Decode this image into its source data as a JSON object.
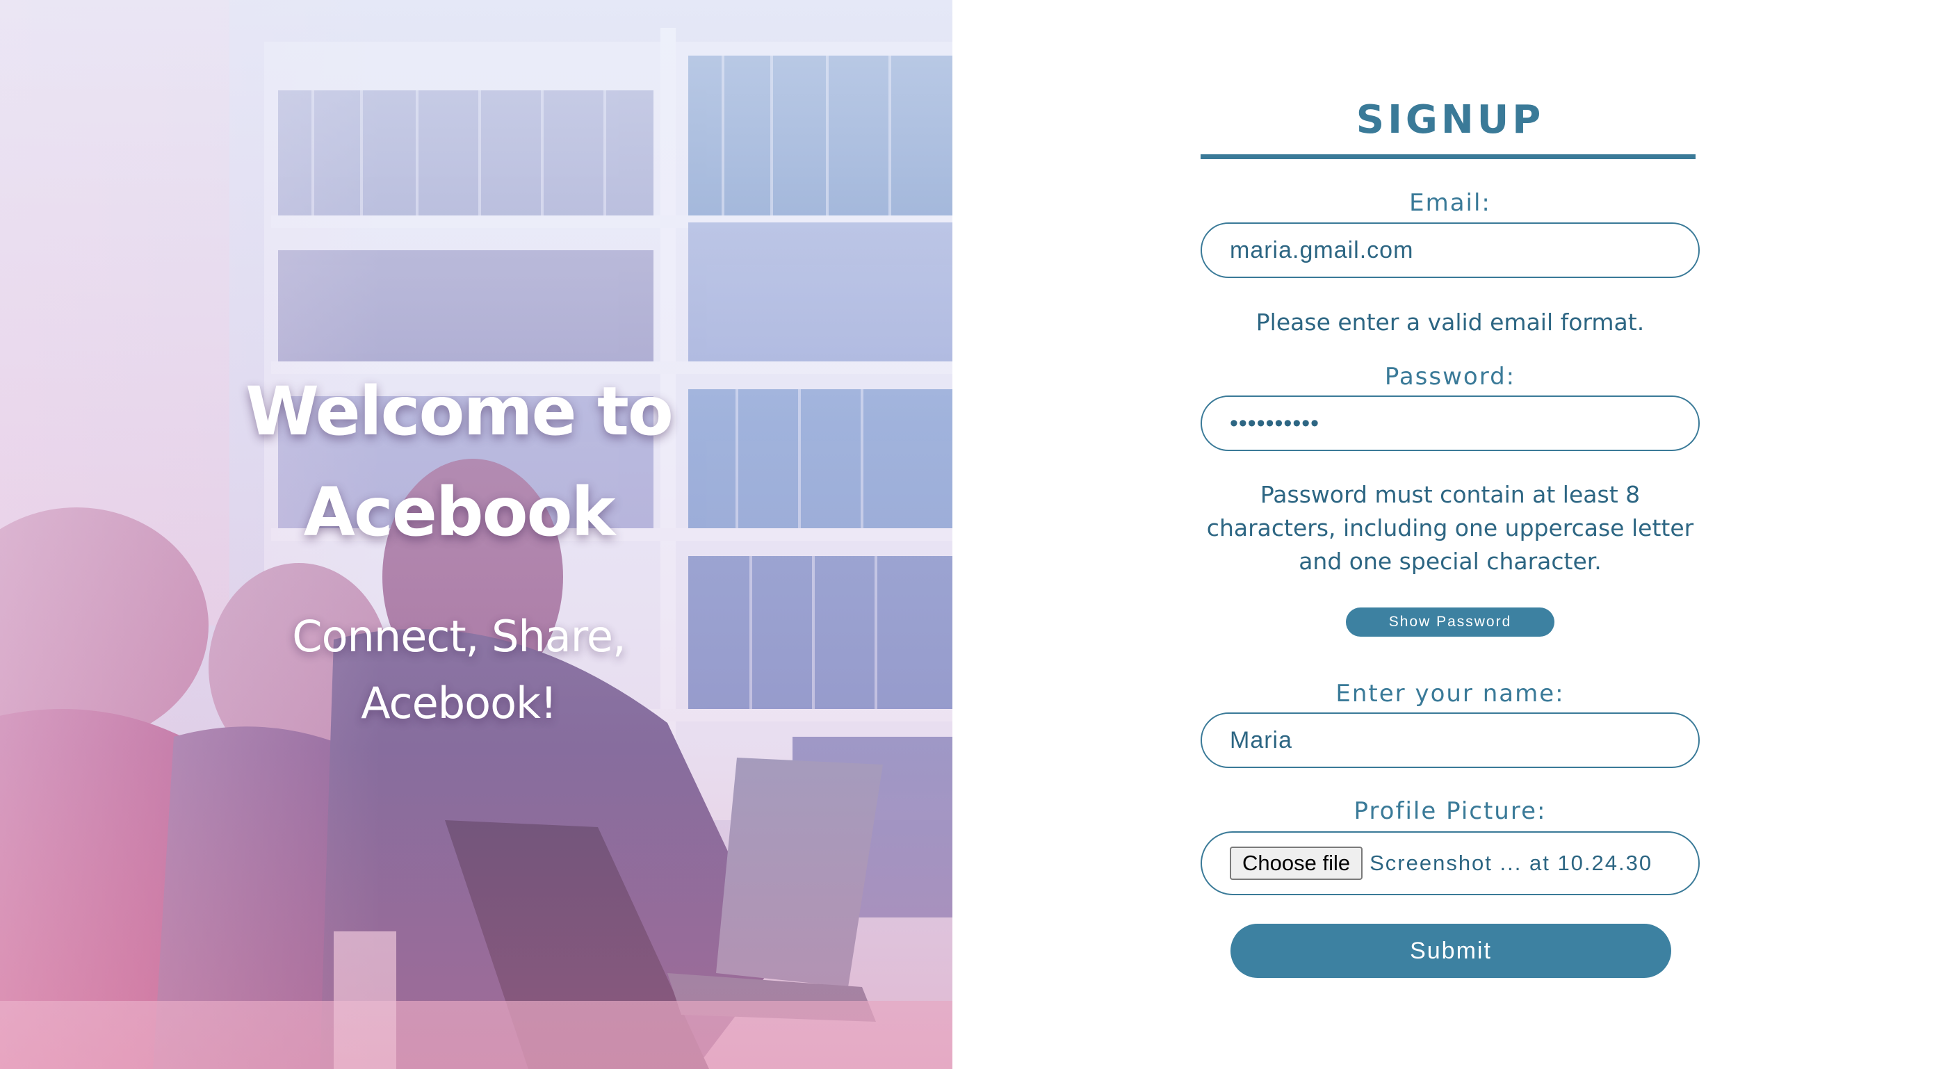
{
  "hero": {
    "title_line1": "Welcome to",
    "title_line2": "Acebook",
    "subtitle_line1": "Connect, Share,",
    "subtitle_line2": "Acebook!"
  },
  "form": {
    "title": "SIGNUP",
    "email": {
      "label": "Email:",
      "value": "maria.gmail.com",
      "error": "Please enter a valid email format."
    },
    "password": {
      "label": "Password:",
      "masked_value": "••••••••••",
      "hint_line1": "Password must contain at least 8",
      "hint_line2": "characters, including one uppercase letter",
      "hint_line3": "and one special character.",
      "show_button": "Show Password"
    },
    "name": {
      "label": "Enter your name:",
      "value": "Maria"
    },
    "profile_picture": {
      "label": "Profile Picture:",
      "button": "Choose file",
      "file_name": "Screenshot ... at 10.24.30"
    },
    "submit": "Submit"
  },
  "colors": {
    "accent": "#3d81a1",
    "text": "#2d6683"
  }
}
